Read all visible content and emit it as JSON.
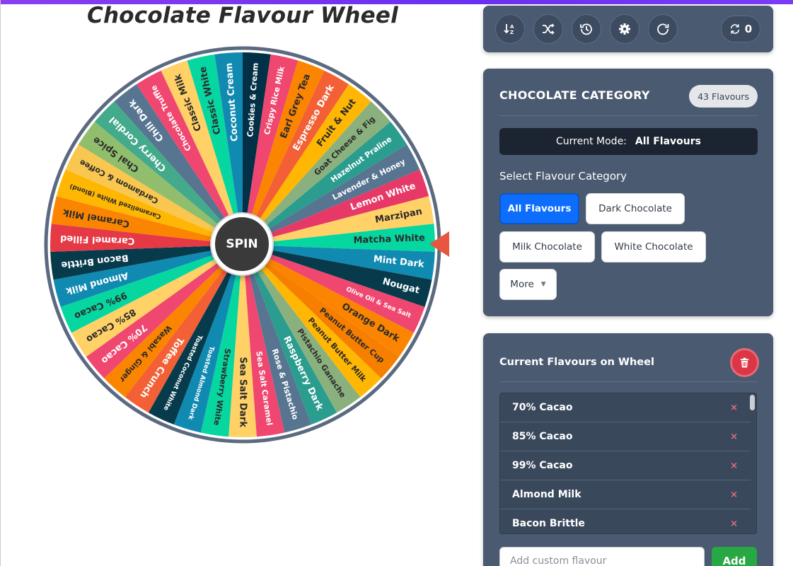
{
  "title": "Chocolate Flavour Wheel",
  "wheel": {
    "spin_label": "SPIN",
    "segments": [
      {
        "label": "Cookies & Cream",
        "color": "#023047"
      },
      {
        "label": "Crispy Rice Milk",
        "color": "#ef476f"
      },
      {
        "label": "Earl Grey Tea",
        "color": "#fb8500"
      },
      {
        "label": "Espresso Dark",
        "color": "#f46036"
      },
      {
        "label": "Fruit & Nut",
        "color": "#ffb703"
      },
      {
        "label": "Goat Cheese & Fig",
        "color": "#8ab17d"
      },
      {
        "label": "Hazelnut Praline",
        "color": "#2a9d8f"
      },
      {
        "label": "Lavender & Honey",
        "color": "#577590"
      },
      {
        "label": "Lemon White",
        "color": "#e63967"
      },
      {
        "label": "Marzipan",
        "color": "#ffd166"
      },
      {
        "label": "Matcha White",
        "color": "#06d6a0"
      },
      {
        "label": "Mint Dark",
        "color": "#118ab2"
      },
      {
        "label": "Nougat",
        "color": "#073b4c"
      },
      {
        "label": "Olive Oil & Sea Salt",
        "color": "#ef476f"
      },
      {
        "label": "Orange Dark",
        "color": "#fb8500"
      },
      {
        "label": "Peanut Butter Cup",
        "color": "#f77f00"
      },
      {
        "label": "Peanut Butter Milk",
        "color": "#ffb703"
      },
      {
        "label": "Pistachio Ganache",
        "color": "#8ab17d"
      },
      {
        "label": "Raspberry Dark",
        "color": "#2a9d8f"
      },
      {
        "label": "Rose & Pistachio",
        "color": "#577590"
      },
      {
        "label": "Sea Salt Caramel",
        "color": "#ef476f"
      },
      {
        "label": "Sea Salt Dark",
        "color": "#ffd166"
      },
      {
        "label": "Strawberry White",
        "color": "#06d6a0"
      },
      {
        "label": "Toasted Almond Dark",
        "color": "#118ab2"
      },
      {
        "label": "Toasted Coconut White",
        "color": "#073b4c"
      },
      {
        "label": "Toffee Crunch",
        "color": "#f46036"
      },
      {
        "label": "Wasabi & Ginger",
        "color": "#fb8500"
      },
      {
        "label": "70% Cacao",
        "color": "#ef476f"
      },
      {
        "label": "85% Cacao",
        "color": "#ffd166"
      },
      {
        "label": "99% Cacao",
        "color": "#06d6a0"
      },
      {
        "label": "Almond Milk",
        "color": "#118ab2"
      },
      {
        "label": "Bacon Brittle",
        "color": "#073b4c"
      },
      {
        "label": "Caramel Filled",
        "color": "#e63946"
      },
      {
        "label": "Caramel Milk",
        "color": "#fb8500"
      },
      {
        "label": "Caramelized White (Blond)",
        "color": "#ffb703"
      },
      {
        "label": "Cardamom & Coffee",
        "color": "#f9c74f"
      },
      {
        "label": "Chai Spice",
        "color": "#90be6d"
      },
      {
        "label": "Cherry Cordial",
        "color": "#43aa8b"
      },
      {
        "label": "Chili Dark",
        "color": "#577590"
      },
      {
        "label": "Chocolate Truffle",
        "color": "#ef476f"
      },
      {
        "label": "Classic Milk",
        "color": "#ffd166"
      },
      {
        "label": "Classic White",
        "color": "#06d6a0"
      },
      {
        "label": "Coconut Cream",
        "color": "#118ab2"
      }
    ]
  },
  "toolbar": {
    "buttons": [
      {
        "name": "sort-icon"
      },
      {
        "name": "shuffle-icon"
      },
      {
        "name": "history-icon"
      },
      {
        "name": "gear-icon"
      },
      {
        "name": "reset-icon"
      }
    ],
    "counter_value": "0"
  },
  "category": {
    "title": "CHOCOLATE CATEGORY",
    "badge": "43 Flavours",
    "mode_label": "Current Mode:",
    "mode_value": "All Flavours",
    "select_label": "Select Flavour Category",
    "chips": [
      "All Flavours",
      "Dark Chocolate",
      "Milk Chocolate",
      "White Chocolate",
      "More"
    ]
  },
  "flavours": {
    "title": "Current Flavours on Wheel",
    "items": [
      "70% Cacao",
      "85% Cacao",
      "99% Cacao",
      "Almond Milk",
      "Bacon Brittle"
    ],
    "remove_symbol": "×",
    "input_placeholder": "Add custom flavour",
    "add_label": "Add"
  }
}
